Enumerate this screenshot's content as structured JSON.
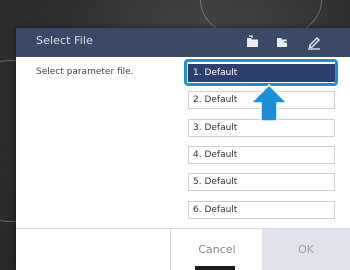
{
  "dialog": {
    "title": "Select File",
    "prompt": "Select parameter file.",
    "files": [
      {
        "label": "1. Default",
        "selected": true
      },
      {
        "label": "2. Default",
        "selected": false
      },
      {
        "label": "3. Default",
        "selected": false
      },
      {
        "label": "4. Default",
        "selected": false
      },
      {
        "label": "5. Default",
        "selected": false
      },
      {
        "label": "6. Default",
        "selected": false
      }
    ],
    "toolbar_icons": [
      "folder-open-icon",
      "folder-swap-icon",
      "edit-pen-icon"
    ],
    "cancel_label": "Cancel",
    "ok_label": "OK"
  },
  "colors": {
    "titlebar": "#3a4a66",
    "selected_item": "#2e3f6e",
    "highlight": "#1d8fd6",
    "ok_disabled_bg": "#dfe3ec"
  }
}
